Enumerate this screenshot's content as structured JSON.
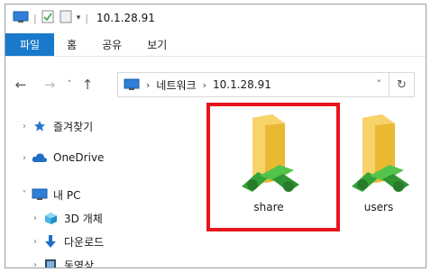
{
  "window": {
    "title": "10.1.28.91",
    "icons": [
      "computer-icon",
      "properties-icon",
      "new-folder-icon",
      "dropdown-icon"
    ]
  },
  "ribbon": {
    "tabs": [
      {
        "label": "파일"
      },
      {
        "label": "홈"
      },
      {
        "label": "공유"
      },
      {
        "label": "보기"
      }
    ]
  },
  "address": {
    "segments": [
      "네트워크",
      "10.1.28.91"
    ]
  },
  "nav": {
    "items": [
      {
        "label": "즐겨찾기",
        "icon": "star-icon",
        "expander": "›"
      },
      {
        "label": "OneDrive",
        "icon": "cloud-icon",
        "expander": "›"
      },
      {
        "label": "내 PC",
        "icon": "computer-icon",
        "expander": "˅"
      },
      {
        "label": "3D 개체",
        "icon": "cube-icon",
        "expander": "›"
      },
      {
        "label": "다운로드",
        "icon": "download-icon",
        "expander": "›"
      },
      {
        "label": "동영상",
        "icon": "video-icon",
        "expander": "›"
      }
    ]
  },
  "content": {
    "items": [
      {
        "label": "share",
        "icon": "shared-folder-icon"
      },
      {
        "label": "users",
        "icon": "shared-folder-icon"
      }
    ]
  },
  "colors": {
    "accent": "#1979ca",
    "highlight": "#e8141c",
    "folder": "#f5c744",
    "network": "#3fae3b"
  }
}
